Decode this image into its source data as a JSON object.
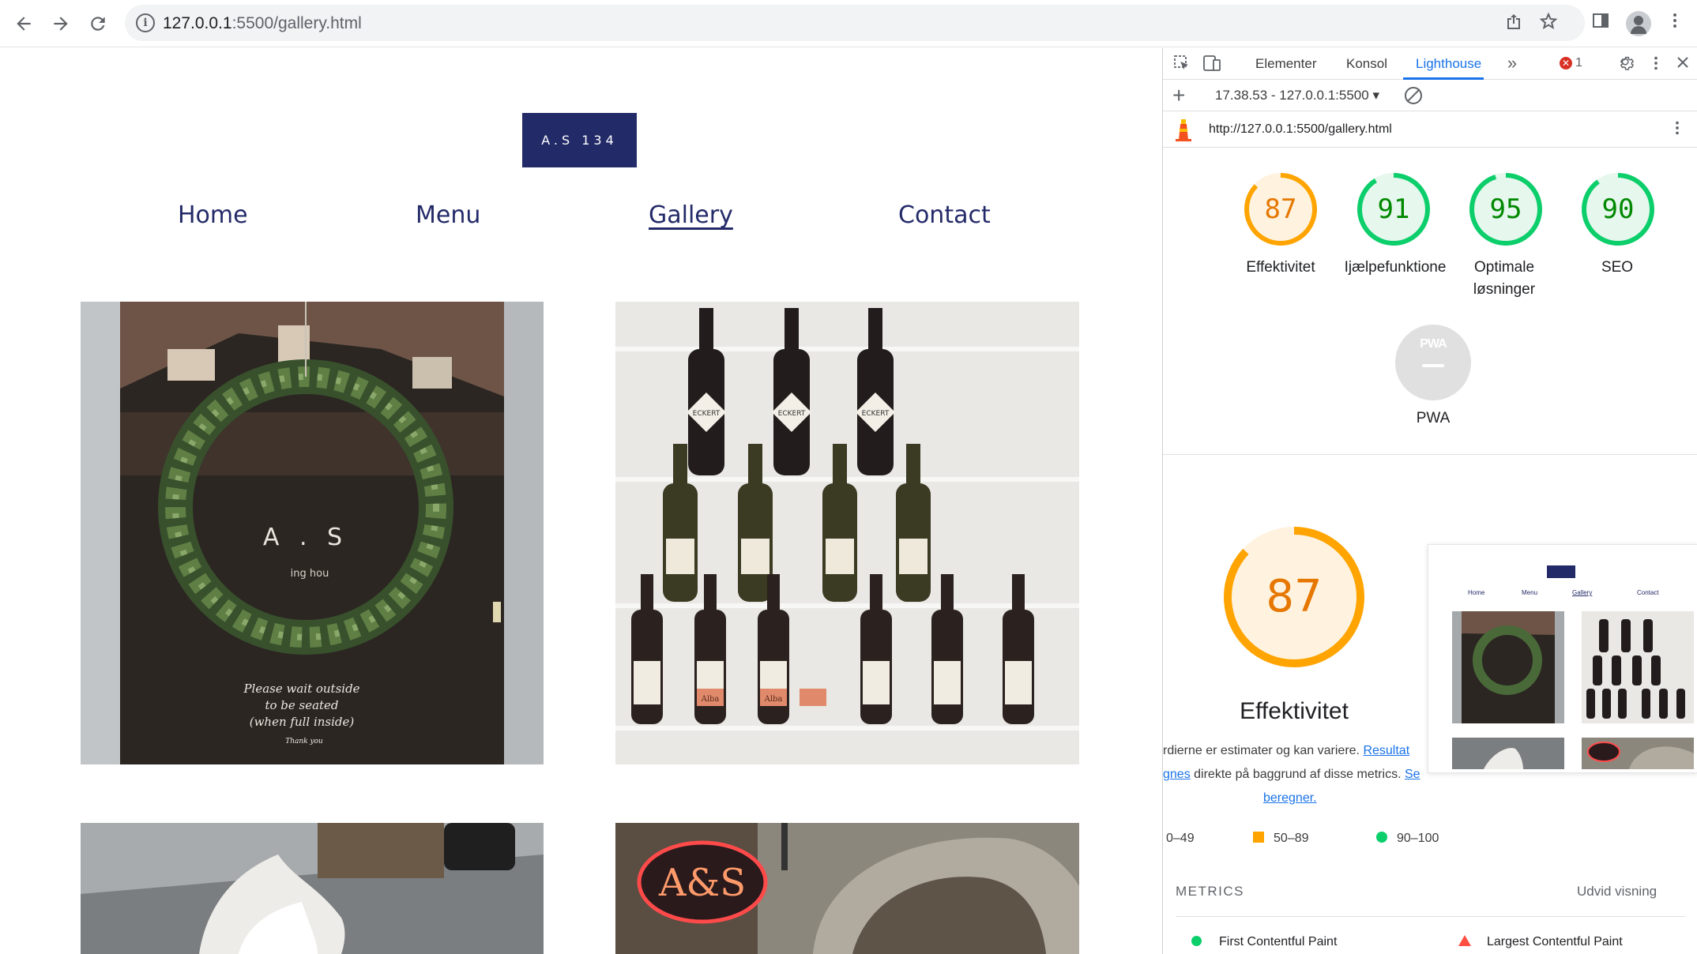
{
  "browser": {
    "url_host": "127.0.0.1",
    "url_rest": ":5500/gallery.html"
  },
  "site": {
    "logo": "A.S 134",
    "nav": [
      {
        "label": "Home",
        "active": false
      },
      {
        "label": "Menu",
        "active": false
      },
      {
        "label": "Gallery",
        "active": true
      },
      {
        "label": "Contact",
        "active": false
      }
    ],
    "photos": {
      "wreath_text_1": "A . S",
      "wreath_text_2": "ing hou",
      "wreath_text_3": "Please wait outside",
      "wreath_text_4": "to be seated",
      "wreath_text_5": "(when full inside)",
      "wreath_text_6": "Thank you",
      "wine_label": "ECKERT",
      "wine_label_2": "Alba",
      "sign_text": "A&S"
    }
  },
  "devtools": {
    "tabs": [
      "Elementer",
      "Konsol",
      "Lighthouse"
    ],
    "active_tab": "Lighthouse",
    "error_count": "1",
    "report_label": "17.38.53 - 127.0.0.1:5500",
    "audited_url": "http://127.0.0.1:5500/gallery.html",
    "scores": [
      {
        "label": "Effektivitet",
        "value": "87",
        "color": "#e67700",
        "ring": "#ffa400",
        "bg": "#fff3e0"
      },
      {
        "label": "Ijælpefunktione",
        "value": "91",
        "color": "#008800",
        "ring": "#0cce6b",
        "bg": "#e6f7ed"
      },
      {
        "label": "Optimale løsninger",
        "value": "95",
        "color": "#008800",
        "ring": "#0cce6b",
        "bg": "#e6f7ed"
      },
      {
        "label": "SEO",
        "value": "90",
        "color": "#008800",
        "ring": "#0cce6b",
        "bg": "#e6f7ed"
      }
    ],
    "optimale_line1": "Optimale",
    "optimale_line2": "løsninger",
    "pwa_label": "PWA",
    "pwa_badge": "PWA",
    "big_score": "87",
    "big_title": "Effektivitet",
    "desc_1_text": "rdierne er estimater og kan variere. ",
    "desc_1_link": "Resultat",
    "desc_2_link": "gnes",
    "desc_2_text": " direkte på baggrund af disse metrics. ",
    "desc_2_link2": "Se",
    "desc_3_link": "beregner.",
    "legend": {
      "low": "0–49",
      "mid": "50–89",
      "high": "90–100"
    },
    "metrics_title": "METRICS",
    "metrics_expand": "Udvid visning",
    "metrics": [
      {
        "label": "First Contentful Paint",
        "status": "good"
      },
      {
        "label": "Largest Contentful Paint",
        "status": "bad"
      }
    ],
    "thumb_nav": [
      "Home",
      "Menu",
      "Gallery",
      "Contact"
    ]
  },
  "colors": {
    "brand_navy": "#232a68",
    "devtools_accent": "#1a73e8",
    "average_orange": "#ffa400",
    "pass_green": "#0cce6b",
    "fail_red": "#ff4e42"
  }
}
